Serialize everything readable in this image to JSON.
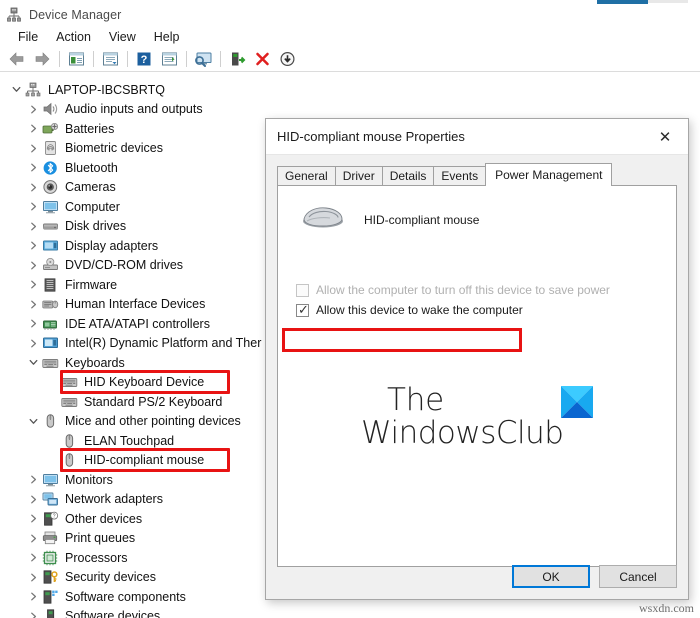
{
  "window": {
    "title": "Device Manager",
    "app_icon": "device-manager-icon"
  },
  "menubar": {
    "items": [
      {
        "label": "File"
      },
      {
        "label": "Action"
      },
      {
        "label": "View"
      },
      {
        "label": "Help"
      }
    ]
  },
  "toolbar": {
    "buttons": [
      {
        "name": "back-button",
        "icon": "left-arrow-icon"
      },
      {
        "name": "forward-button",
        "icon": "right-arrow-icon"
      },
      {
        "name": "separator-1",
        "icon": "separator"
      },
      {
        "name": "properties-button",
        "icon": "properties-window-icon"
      },
      {
        "name": "separator-2",
        "icon": "separator"
      },
      {
        "name": "update-driver-button",
        "icon": "document-window-icon"
      },
      {
        "name": "separator-3",
        "icon": "separator"
      },
      {
        "name": "help-button",
        "icon": "question-mark-icon"
      },
      {
        "name": "show-hidden-button",
        "icon": "list-window-icon"
      },
      {
        "name": "separator-4",
        "icon": "separator"
      },
      {
        "name": "scan-hardware-button",
        "icon": "monitor-scan-icon"
      },
      {
        "name": "separator-5",
        "icon": "separator"
      },
      {
        "name": "enable-device-button",
        "icon": "device-enable-icon"
      },
      {
        "name": "uninstall-device-button",
        "icon": "red-x-icon"
      },
      {
        "name": "update-driver-down-button",
        "icon": "download-arrow-icon"
      }
    ]
  },
  "tree": {
    "nodes": [
      {
        "label": "LAPTOP-IBCSBRTQ",
        "indent": 0,
        "state": "expanded",
        "icon": "computer-root-icon",
        "highlight": false
      },
      {
        "label": "Audio inputs and outputs",
        "indent": 1,
        "state": "collapsed",
        "icon": "speaker-icon",
        "highlight": false
      },
      {
        "label": "Batteries",
        "indent": 1,
        "state": "collapsed",
        "icon": "battery-icon",
        "highlight": false
      },
      {
        "label": "Biometric devices",
        "indent": 1,
        "state": "collapsed",
        "icon": "fingerprint-icon",
        "highlight": false
      },
      {
        "label": "Bluetooth",
        "indent": 1,
        "state": "collapsed",
        "icon": "bluetooth-icon",
        "highlight": false
      },
      {
        "label": "Cameras",
        "indent": 1,
        "state": "collapsed",
        "icon": "camera-icon",
        "highlight": false
      },
      {
        "label": "Computer",
        "indent": 1,
        "state": "collapsed",
        "icon": "monitor-icon",
        "highlight": false
      },
      {
        "label": "Disk drives",
        "indent": 1,
        "state": "collapsed",
        "icon": "disk-drive-icon",
        "highlight": false
      },
      {
        "label": "Display adapters",
        "indent": 1,
        "state": "collapsed",
        "icon": "display-adapter-icon",
        "highlight": false
      },
      {
        "label": "DVD/CD-ROM drives",
        "indent": 1,
        "state": "collapsed",
        "icon": "optical-drive-icon",
        "highlight": false
      },
      {
        "label": "Firmware",
        "indent": 1,
        "state": "collapsed",
        "icon": "firmware-chip-icon",
        "highlight": false
      },
      {
        "label": "Human Interface Devices",
        "indent": 1,
        "state": "collapsed",
        "icon": "hid-icon",
        "highlight": false
      },
      {
        "label": "IDE ATA/ATAPI controllers",
        "indent": 1,
        "state": "collapsed",
        "icon": "ide-controller-icon",
        "highlight": false
      },
      {
        "label": "Intel(R) Dynamic Platform and Ther",
        "indent": 1,
        "state": "collapsed",
        "icon": "system-device-icon",
        "highlight": false
      },
      {
        "label": "Keyboards",
        "indent": 1,
        "state": "expanded",
        "icon": "keyboard-icon",
        "highlight": false
      },
      {
        "label": "HID Keyboard Device",
        "indent": 2,
        "state": "leaf",
        "icon": "keyboard-icon",
        "highlight": true
      },
      {
        "label": "Standard PS/2 Keyboard",
        "indent": 2,
        "state": "leaf",
        "icon": "keyboard-icon",
        "highlight": false
      },
      {
        "label": "Mice and other pointing devices",
        "indent": 1,
        "state": "expanded",
        "icon": "mouse-icon",
        "highlight": false
      },
      {
        "label": "ELAN Touchpad",
        "indent": 2,
        "state": "leaf",
        "icon": "mouse-icon",
        "highlight": false
      },
      {
        "label": "HID-compliant mouse",
        "indent": 2,
        "state": "leaf",
        "icon": "mouse-icon",
        "highlight": true
      },
      {
        "label": "Monitors",
        "indent": 1,
        "state": "collapsed",
        "icon": "monitor-icon",
        "highlight": false
      },
      {
        "label": "Network adapters",
        "indent": 1,
        "state": "collapsed",
        "icon": "network-adapter-icon",
        "highlight": false
      },
      {
        "label": "Other devices",
        "indent": 1,
        "state": "collapsed",
        "icon": "unknown-device-icon",
        "highlight": false
      },
      {
        "label": "Print queues",
        "indent": 1,
        "state": "collapsed",
        "icon": "printer-icon",
        "highlight": false
      },
      {
        "label": "Processors",
        "indent": 1,
        "state": "collapsed",
        "icon": "processor-icon",
        "highlight": false
      },
      {
        "label": "Security devices",
        "indent": 1,
        "state": "collapsed",
        "icon": "security-device-icon",
        "highlight": false
      },
      {
        "label": "Software components",
        "indent": 1,
        "state": "collapsed",
        "icon": "software-component-icon",
        "highlight": false
      },
      {
        "label": "Software devices",
        "indent": 1,
        "state": "collapsed",
        "icon": "software-device-icon",
        "highlight": false
      }
    ]
  },
  "dialog": {
    "title": "HID-compliant mouse Properties",
    "close_label": "✕",
    "tabs": [
      {
        "label": "General",
        "active": false
      },
      {
        "label": "Driver",
        "active": false
      },
      {
        "label": "Details",
        "active": false
      },
      {
        "label": "Events",
        "active": false
      },
      {
        "label": "Power Management",
        "active": true
      }
    ],
    "device_name": "HID-compliant mouse",
    "device_icon": "mouse-device-icon",
    "checkboxes": [
      {
        "label": "Allow the computer to turn off this device to save power",
        "checked": false,
        "disabled": true,
        "highlight": false
      },
      {
        "label": "Allow this device to wake the computer",
        "checked": true,
        "disabled": false,
        "highlight": true
      }
    ],
    "logo": {
      "line1": "The",
      "line2": "WindowsClub",
      "mark_colors": [
        "#1fb6ff",
        "#0a66d0",
        "#1891e8",
        "#3ccbff"
      ]
    },
    "buttons": [
      {
        "label": "OK",
        "default": true
      },
      {
        "label": "Cancel",
        "default": false
      }
    ]
  },
  "highlight_color": "#e81313",
  "watermark": "wsxdn.com"
}
